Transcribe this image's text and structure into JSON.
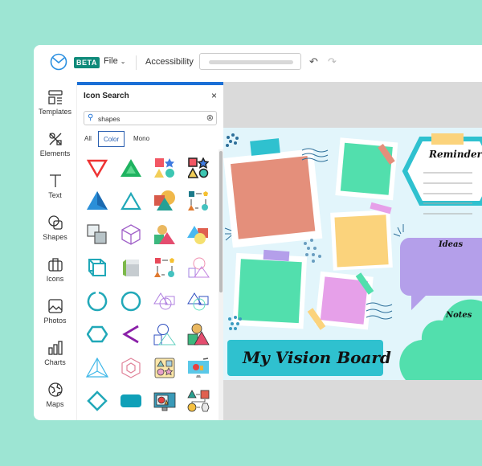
{
  "topbar": {
    "beta": "BETA",
    "file": "File",
    "accessibility": "Accessibility",
    "undo_icon": "undo-icon",
    "redo_icon": "redo-icon"
  },
  "sidebar": {
    "items": [
      {
        "label": "Templates",
        "icon": "templates-icon"
      },
      {
        "label": "Elements",
        "icon": "elements-icon"
      },
      {
        "label": "Text",
        "icon": "text-icon"
      },
      {
        "label": "Shapes",
        "icon": "shapes-icon"
      },
      {
        "label": "Icons",
        "icon": "icons-icon"
      },
      {
        "label": "Photos",
        "icon": "photos-icon"
      },
      {
        "label": "Charts",
        "icon": "charts-icon"
      },
      {
        "label": "Maps",
        "icon": "maps-icon"
      }
    ]
  },
  "panel": {
    "title": "Icon Search",
    "search_value": "shapes",
    "tabs": [
      "All",
      "Color",
      "Mono"
    ],
    "active_tab": "Color"
  },
  "board": {
    "title": "My Vision Board",
    "reminder": "Reminder",
    "ideas": "Ideas",
    "notes": "Notes"
  },
  "colors": {
    "accent": "#1a6fd6",
    "beta": "#0f8a7a",
    "teal": "#2fc1cf",
    "green": "#52dfad",
    "coral": "#e48f7b",
    "yellow": "#fbd37c",
    "purple": "#b49fea",
    "pink": "#e6a0e9"
  }
}
